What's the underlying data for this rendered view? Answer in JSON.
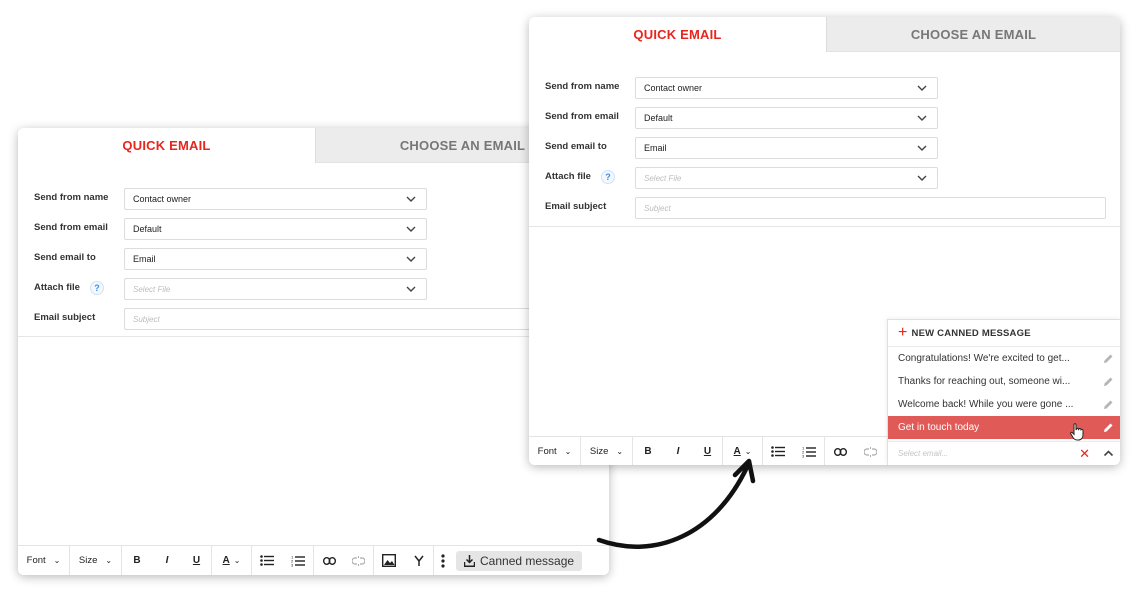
{
  "tabs": {
    "quick_email": "QUICK EMAIL",
    "choose_email": "CHOOSE AN EMAIL"
  },
  "form": {
    "send_from_name": {
      "label": "Send from name",
      "value": "Contact owner"
    },
    "send_from_email": {
      "label": "Send from email",
      "value": "Default"
    },
    "send_email_to": {
      "label": "Send email to",
      "value": "Email"
    },
    "attach_file": {
      "label": "Attach file",
      "help": "?",
      "placeholder": "Select File"
    },
    "email_subject": {
      "label": "Email subject",
      "placeholder": "Subject"
    }
  },
  "toolbar": {
    "font": "Font",
    "size": "Size",
    "bold": "B",
    "italic": "I",
    "underline": "U",
    "text_color": "A",
    "canned_message": "Canned message"
  },
  "dropdown": {
    "new_label": "NEW CANNED MESSAGE",
    "items": [
      "Congratulations! We're excited to get...",
      "Thanks for reaching out, someone wi...",
      "Welcome back! While you were gone ...",
      "Get in touch today"
    ],
    "selected_index": 3,
    "search_placeholder": "Select email..."
  },
  "colors": {
    "accent": "#e8261d",
    "selected_item": "#e05a57",
    "help_icon": "#3a8ee6"
  }
}
